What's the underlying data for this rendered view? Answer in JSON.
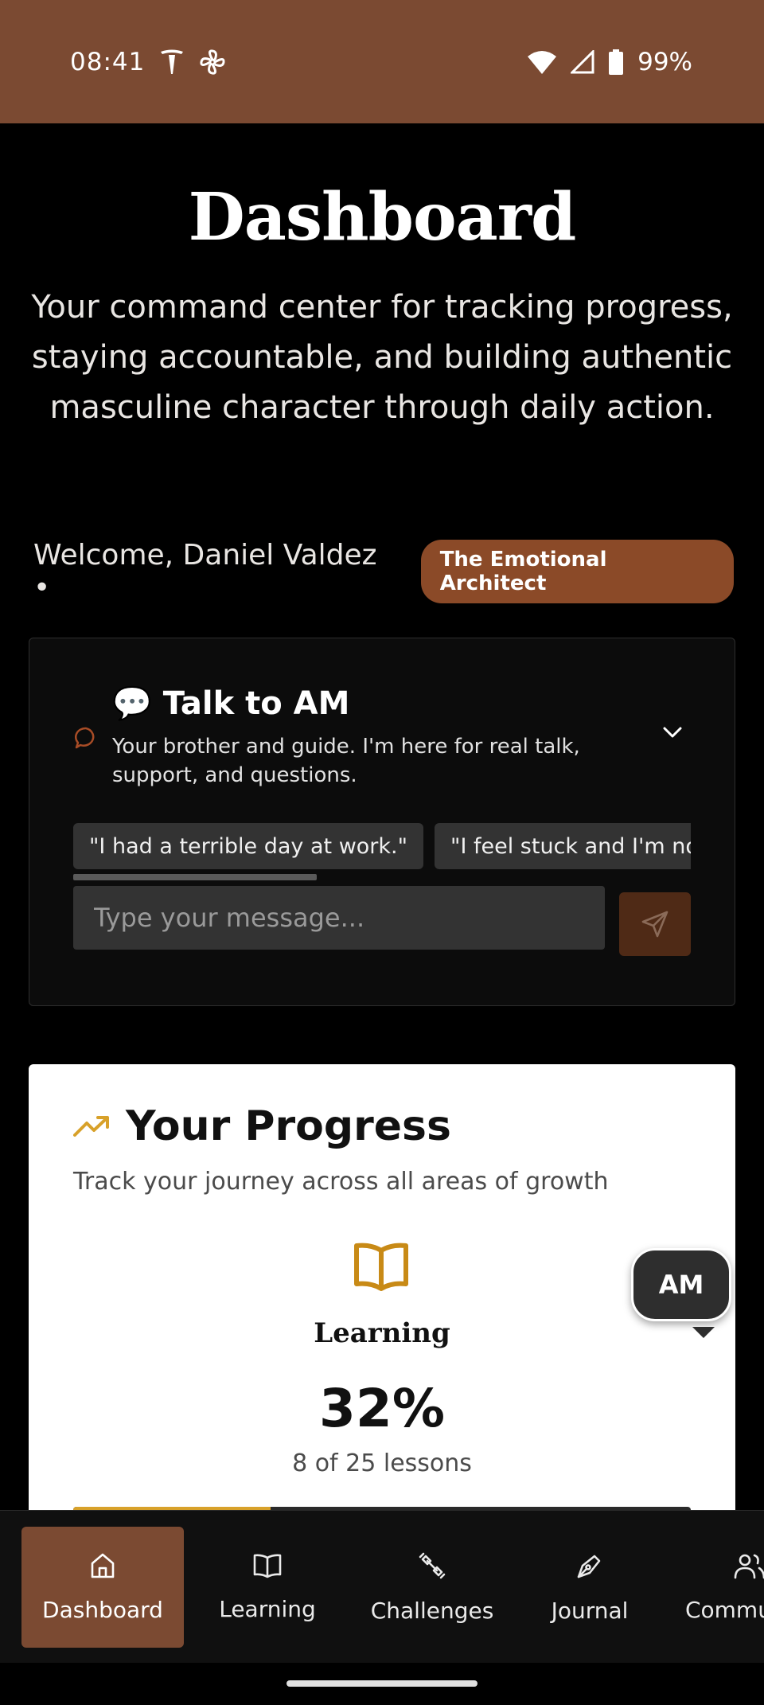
{
  "status_bar": {
    "time": "08:41",
    "battery": "99%",
    "icons": [
      "tesla-icon",
      "fan-icon",
      "wifi-icon",
      "signal-icon",
      "battery-icon"
    ]
  },
  "header": {
    "title": "Dashboard",
    "subtitle": "Your command center for tracking progress, staying accountable, and building authentic masculine character through daily action."
  },
  "welcome": {
    "text": "Welcome, Daniel Valdez •",
    "badge": "The Emotional Architect"
  },
  "chat": {
    "title": "💬 Talk to AM",
    "description": "Your brother and guide. I'm here for real talk, support, and questions.",
    "prompts": [
      "\"I had a terrible day at work.\"",
      "\"I feel stuck and I'm not sure what to do.\""
    ],
    "input_placeholder": "Type your message...",
    "input_value": ""
  },
  "progress": {
    "title": "Your Progress",
    "description": "Track your journey across all areas of growth",
    "learning": {
      "label": "Learning",
      "percent_text": "32%",
      "count_text": "8 of 25 lessons",
      "fraction": 0.32
    }
  },
  "fab": {
    "label": "AM"
  },
  "nav": {
    "items": [
      {
        "label": "Dashboard",
        "icon": "home-icon",
        "active": true
      },
      {
        "label": "Learning",
        "icon": "book-icon",
        "active": false
      },
      {
        "label": "Challenges",
        "icon": "dumbbell-icon",
        "active": false
      },
      {
        "label": "Journal",
        "icon": "pen-icon",
        "active": false
      },
      {
        "label": "Community",
        "icon": "users-icon",
        "active": false
      }
    ]
  },
  "colors": {
    "status_bar": "#7b4a32",
    "badge": "#8b4a28",
    "accent_gold": "#d8a12a",
    "nav_active": "#7b4a32"
  }
}
